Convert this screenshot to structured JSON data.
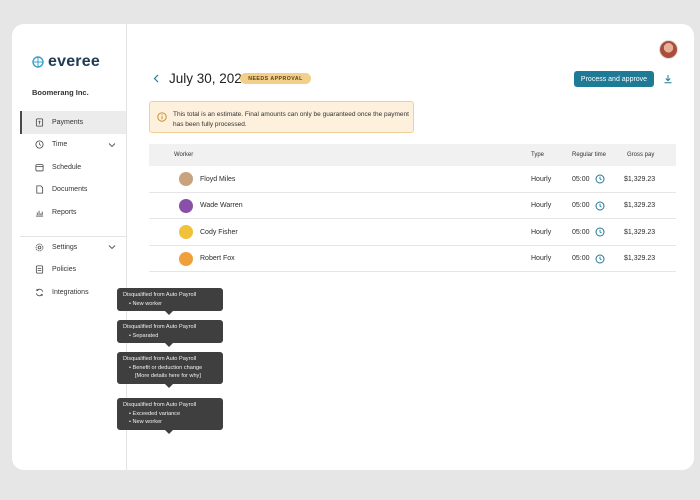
{
  "brand": {
    "name": "everee",
    "color": "#1f3a55",
    "accent": "#1f7a95"
  },
  "company": "Boomerang Inc.",
  "nav": {
    "items": [
      {
        "label": "Payments",
        "icon": "payments-icon",
        "active": true
      },
      {
        "label": "Time",
        "icon": "clock-icon",
        "has_chevron": true
      },
      {
        "label": "Schedule",
        "icon": "calendar-icon"
      },
      {
        "label": "Documents",
        "icon": "document-icon"
      },
      {
        "label": "Reports",
        "icon": "bar-chart-icon"
      }
    ],
    "items2": [
      {
        "label": "Settings",
        "icon": "gear-icon",
        "has_chevron": true
      },
      {
        "label": "Policies",
        "icon": "policy-icon"
      },
      {
        "label": "Integrations",
        "icon": "sync-icon"
      }
    ]
  },
  "header": {
    "title": "July 30, 2022",
    "status_badge": "NEEDS APPROVAL",
    "primary_action": "Process and approve"
  },
  "notice": {
    "text": "This total is an estimate. Final amounts can only be guaranteed once the payment has been fully processed."
  },
  "table": {
    "columns": {
      "worker": "Worker",
      "type": "Type",
      "regular": "Regular time",
      "gross": "Gross pay"
    },
    "rows": [
      {
        "name": "Floyd Miles",
        "type": "Hourly",
        "regular": "05:00",
        "gross": "$1,329.23",
        "avatar_color": "#c9a27e"
      },
      {
        "name": "Wade Warren",
        "type": "Hourly",
        "regular": "05:00",
        "gross": "$1,329.23",
        "avatar_color": "#8a4fa8"
      },
      {
        "name": "Cody Fisher",
        "type": "Hourly",
        "regular": "05:00",
        "gross": "$1,329.23",
        "avatar_color": "#f0c23a"
      },
      {
        "name": "Robert Fox",
        "type": "Hourly",
        "regular": "05:00",
        "gross": "$1,329.23",
        "avatar_color": "#f0a03a"
      }
    ]
  },
  "tooltips": [
    {
      "title": "Disqualified from Auto Payroll",
      "bullets": [
        "New worker"
      ]
    },
    {
      "title": "Disqualified from Auto Payroll",
      "bullets": [
        "Separated"
      ]
    },
    {
      "title": "Disqualified from Auto Payroll",
      "bullets": [
        "Benefit or deduction change"
      ],
      "extra": "[More details here for why]"
    },
    {
      "title": "Disqualified from Auto Payroll",
      "bullets": [
        "Exceeded variance",
        "New worker"
      ]
    }
  ],
  "colors": {
    "badge_bg": "#f2cf8a",
    "notice_bg": "#fdf0dd",
    "tooltip_bg": "#3f3f3f",
    "clock": "#1f7a95"
  }
}
